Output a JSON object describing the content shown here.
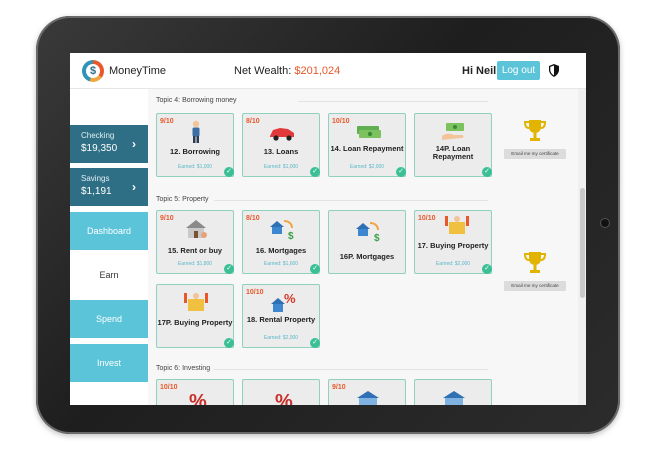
{
  "header": {
    "brand": "MoneyTime",
    "net_wealth_label": "Net Wealth:",
    "net_wealth_value": "$201,024",
    "greeting": "Hi Neil!",
    "logout_label": "Log out"
  },
  "sidebar": {
    "checking": {
      "label": "Checking",
      "amount": "$19,350"
    },
    "savings": {
      "label": "Savings",
      "amount": "$1,191"
    },
    "nav": [
      "Dashboard",
      "Earn",
      "Spend",
      "Invest"
    ]
  },
  "topics": [
    {
      "title": "Topic 4: Borrowing money",
      "certificate": "Email me my certificate",
      "cards": [
        {
          "score": "9/10",
          "title": "12. Borrowing",
          "earned": "Earned: $1,000",
          "icon": "person-icon"
        },
        {
          "score": "8/10",
          "title": "13. Loans",
          "earned": "Earned: $1,000",
          "icon": "car-icon"
        },
        {
          "score": "10/10",
          "title": "14. Loan Repayment",
          "earned": "Earned: $2,000",
          "icon": "money-stack-icon"
        },
        {
          "score": "",
          "title": "14P. Loan Repayment",
          "earned": "",
          "icon": "hand-money-icon"
        }
      ]
    },
    {
      "title": "Topic 5: Property",
      "certificate": "Email me my certificate",
      "cards": [
        {
          "score": "9/10",
          "title": "15. Rent or buy",
          "earned": "Earned: $1,800",
          "icon": "house-icon"
        },
        {
          "score": "8/10",
          "title": "16. Mortgages",
          "earned": "Earned: $1,600",
          "icon": "house-dollar-icon"
        },
        {
          "score": "",
          "title": "16P. Mortgages",
          "earned": "",
          "icon": "house-dollar-icon"
        },
        {
          "score": "10/10",
          "title": "17. Buying Property",
          "earned": "Earned: $2,000",
          "icon": "buyer-icon"
        },
        {
          "score": "",
          "title": "17P. Buying Property",
          "earned": "",
          "icon": "buyer-icon"
        },
        {
          "score": "10/10",
          "title": "18. Rental Property",
          "earned": "Earned: $2,000",
          "icon": "house-percent-icon"
        }
      ]
    },
    {
      "title": "Topic 6: Investing",
      "cards": [
        {
          "score": "10/10",
          "icon": "percent-icon"
        },
        {
          "score": "",
          "icon": "percent-icon"
        },
        {
          "score": "9/10",
          "icon": "building-icon"
        },
        {
          "score": "",
          "icon": "building-icon"
        }
      ]
    }
  ],
  "colors": {
    "accent": "#5bc4d9",
    "account_panel": "#2f6f85",
    "wealth": "#e8582a",
    "complete": "#3bbf94"
  }
}
